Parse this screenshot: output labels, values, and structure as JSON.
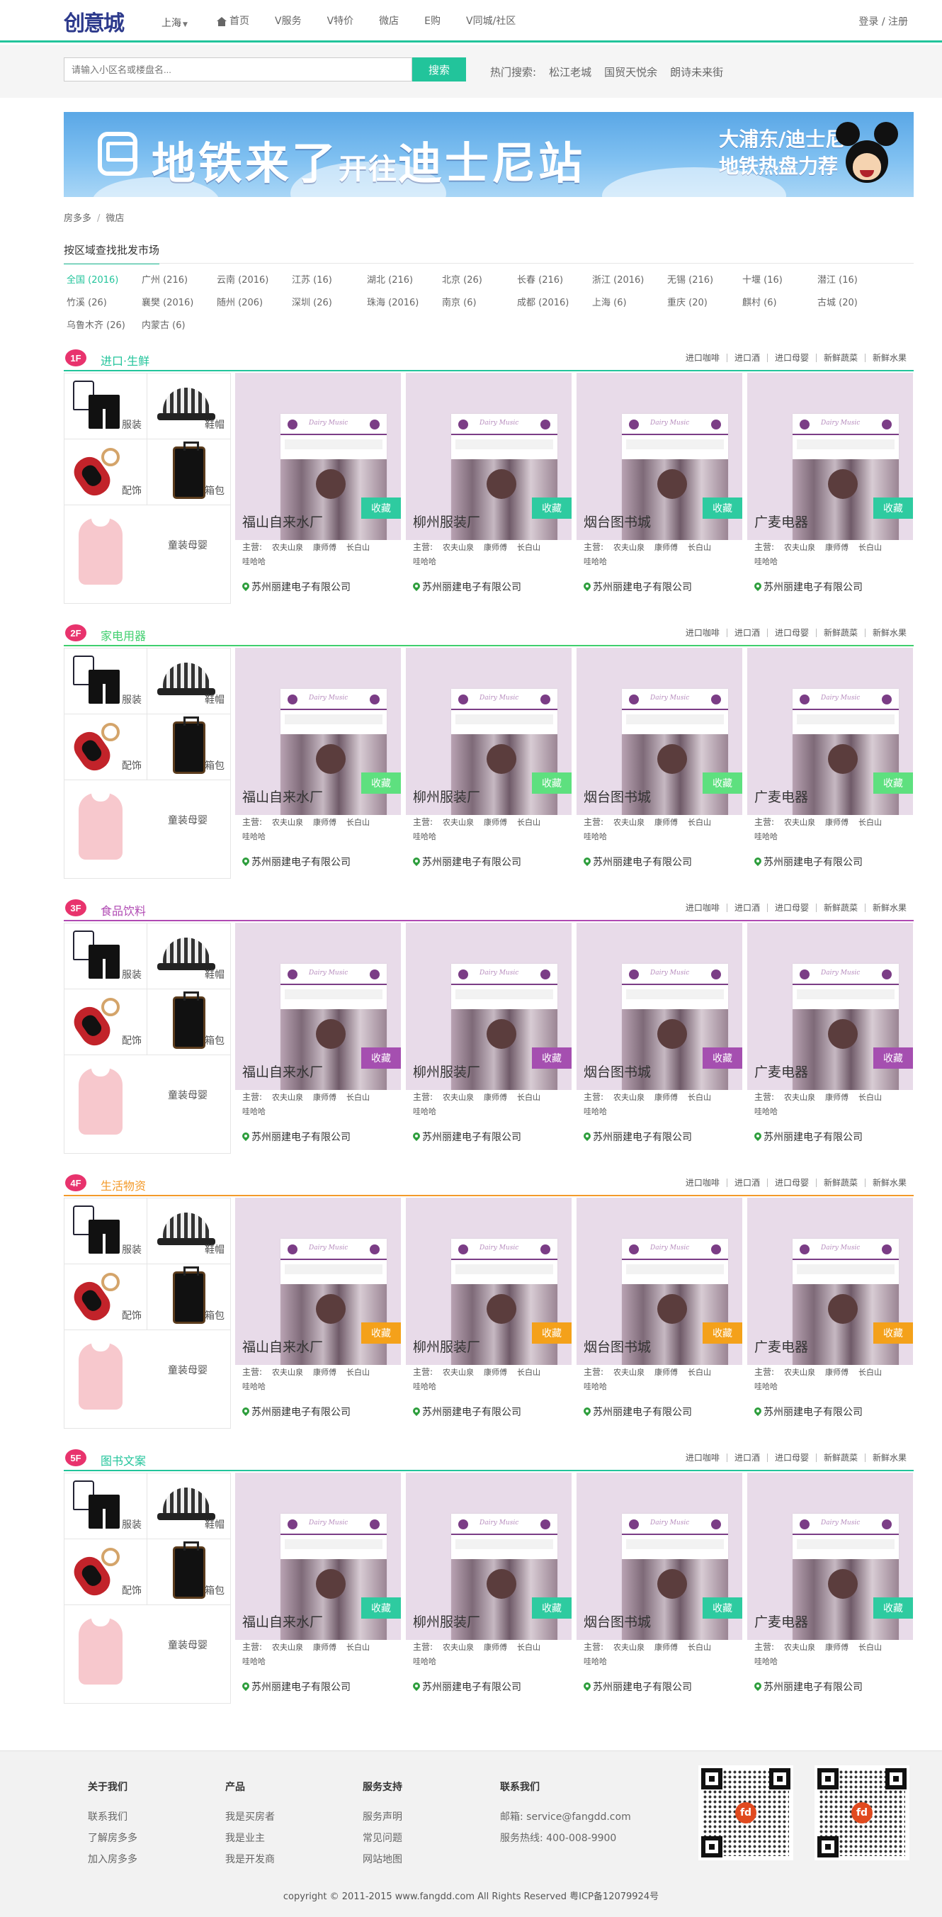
{
  "header": {
    "logo_text": "创意城",
    "city": "上海",
    "nav": [
      "首页",
      "V服务",
      "V特价",
      "微店",
      "E购",
      "V同城/社区"
    ],
    "login": "登录 / 注册"
  },
  "search": {
    "placeholder": "请输入小区名或楼盘名...",
    "button": "搜索",
    "hot_label": "热门搜索:",
    "hot_items": [
      "松江老城",
      "国贸天悦余",
      "朗诗未来街"
    ]
  },
  "banner": {
    "title_a": "地铁来了",
    "title_b": "开往",
    "title_c": "迪士尼站",
    "sub1": "大浦东/迪士尼",
    "sub2": "地铁热盘力荐"
  },
  "breadcrumb": [
    "房多多",
    "微店"
  ],
  "area": {
    "title": "按区域查找批发市场",
    "items": [
      "全国 (2016)",
      "广州 (216)",
      "云南 (2016)",
      "江苏 (16)",
      "湖北 (216)",
      "北京 (26)",
      "长春 (216)",
      "浙江 (2016)",
      "无锡 (216)",
      "十堰 (16)",
      "潜江 (16)",
      "竹溪 (26)",
      "襄樊 (2016)",
      "随州 (206)",
      "深圳 (26)",
      "珠海 (2016)",
      "南京 (6)",
      "成都 (2016)",
      "上海 (6)",
      "重庆 (20)",
      "麒村 (6)",
      "古城 (20)",
      "乌鲁木齐 (26)",
      "内蒙古 (6)"
    ]
  },
  "floor_links": [
    "进口咖啡",
    "进口酒",
    "进口母婴",
    "新鲜蔬菜",
    "新鲜水果"
  ],
  "categories": [
    "服装",
    "鞋帽",
    "配饰",
    "箱包",
    "童装母婴"
  ],
  "cards": [
    {
      "title": "福山自来水厂",
      "main": "主营:",
      "tags": [
        "农夫山泉",
        "康师傅",
        "长白山",
        "哇哈哈"
      ],
      "company": "苏州丽建电子有限公司"
    },
    {
      "title": "柳州服装厂",
      "main": "主营:",
      "tags": [
        "农夫山泉",
        "康师傅",
        "长白山",
        "哇哈哈"
      ],
      "company": "苏州丽建电子有限公司"
    },
    {
      "title": "烟台图书城",
      "main": "主营:",
      "tags": [
        "农夫山泉",
        "康师傅",
        "长白山",
        "哇哈哈"
      ],
      "company": "苏州丽建电子有限公司"
    },
    {
      "title": "广麦电器",
      "main": "主营:",
      "tags": [
        "农夫山泉",
        "康师傅",
        "长白山",
        "哇哈哈"
      ],
      "company": "苏州丽建电子有限公司"
    }
  ],
  "card_fav": "收藏",
  "card_phone_text": "Dairy Music",
  "floors": [
    {
      "badge": "1F",
      "name": "进口·生鲜",
      "color": "#22c49b",
      "name_color": "#22c49b",
      "fav_color": "#2ecba0"
    },
    {
      "badge": "2F",
      "name": "家电用器",
      "color": "#3fcf6e",
      "name_color": "#3fcf6e",
      "fav_color": "#5ee07f"
    },
    {
      "badge": "3F",
      "name": "食品饮料",
      "color": "#b04ab3",
      "name_color": "#b04ab3",
      "fav_color": "#a54fb0"
    },
    {
      "badge": "4F",
      "name": "生活物资",
      "color": "#f39a2a",
      "name_color": "#f39a2a",
      "fav_color": "#f4a11a"
    },
    {
      "badge": "5F",
      "name": "图书文案",
      "color": "#22c49b",
      "name_color": "#22c49b",
      "fav_color": "#2ecba0"
    }
  ],
  "badge_color": "#e8336d",
  "footer": {
    "cols": [
      {
        "title": "关于我们",
        "links": [
          "联系我们",
          "了解房多多",
          "加入房多多"
        ]
      },
      {
        "title": "产品",
        "links": [
          "我是买房者",
          "我是业主",
          "我是开发商"
        ]
      },
      {
        "title": "服务支持",
        "links": [
          "服务声明",
          "常见问题",
          "网站地图"
        ]
      },
      {
        "title": "联系我们",
        "links": [
          "邮箱: service@fangdd.com",
          "服务热线: 400-008-9900"
        ]
      }
    ],
    "qr_logo": "fd",
    "copyright": "copyright © 2011-2015 www.fangdd.com All Rights Reserved 粤ICP备12079924号"
  }
}
